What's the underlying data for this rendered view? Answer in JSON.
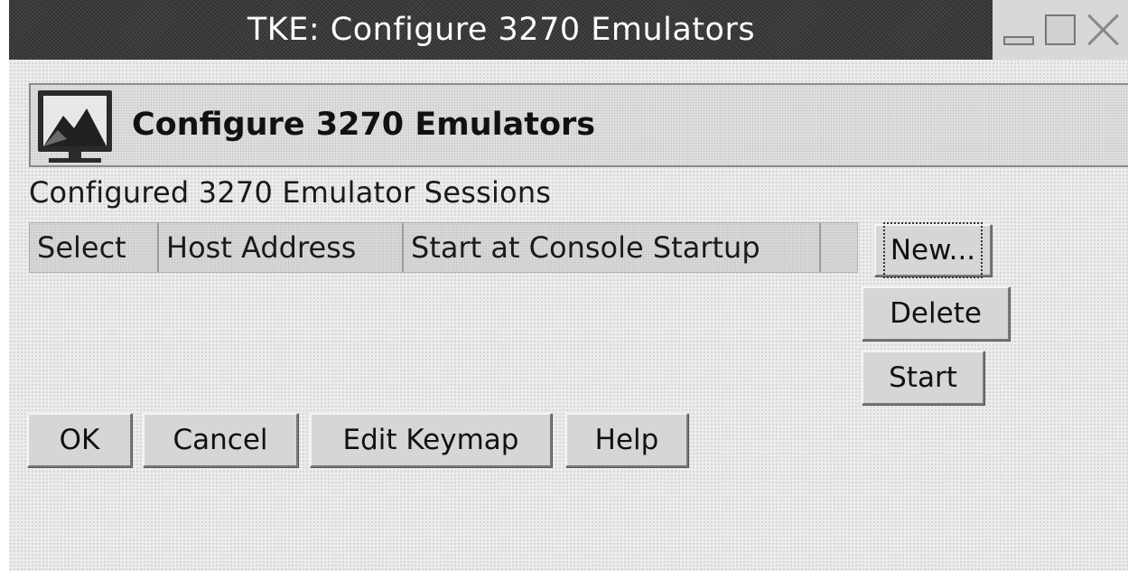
{
  "window": {
    "title": "TKE: Configure 3270 Emulators"
  },
  "header": {
    "title": "Configure 3270 Emulators",
    "icon": "monitor-icon"
  },
  "sessions": {
    "label": "Configured 3270 Emulator Sessions",
    "columns": [
      "Select",
      "Host Address",
      "Start at Console Startup"
    ],
    "rows": []
  },
  "side_buttons": {
    "new_label": "New...",
    "delete_label": "Delete",
    "start_label": "Start"
  },
  "bottom_buttons": {
    "ok_label": "OK",
    "cancel_label": "Cancel",
    "edit_keymap_label": "Edit Keymap",
    "help_label": "Help"
  },
  "icons": {
    "minimize": "minimize-icon",
    "maximize": "maximize-icon",
    "close": "close-icon"
  }
}
